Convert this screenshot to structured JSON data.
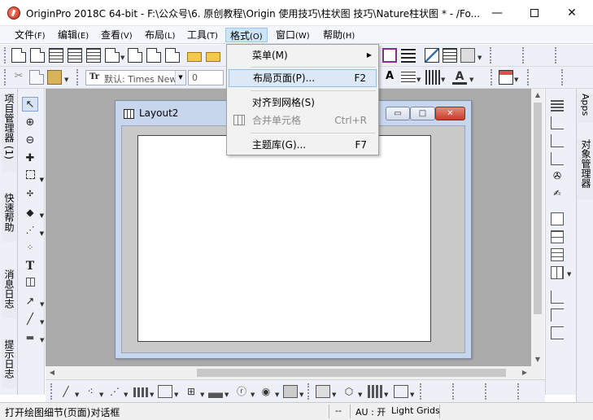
{
  "window": {
    "title": "OriginPro 2018C 64-bit - F:\\公众号\\6. 原创教程\\Origin 使用技巧\\柱状图 技巧\\Nature柱状图 * - /Fo...",
    "minimize_glyph": "—",
    "close_glyph": "✕"
  },
  "menubar": [
    {
      "label": "文件",
      "acc": "(F)"
    },
    {
      "label": "编辑",
      "acc": "(E)"
    },
    {
      "label": "查看",
      "acc": "(V)"
    },
    {
      "label": "布局",
      "acc": "(L)"
    },
    {
      "label": "工具",
      "acc": "(T)"
    },
    {
      "label": "格式",
      "acc": "(O)"
    },
    {
      "label": "窗口",
      "acc": "(W)"
    },
    {
      "label": "帮助",
      "acc": "(H)"
    }
  ],
  "toolbar2": {
    "font_name": "默认: Times New",
    "font_size": "0",
    "font_icon": "Tr"
  },
  "format_menu": {
    "items": [
      {
        "label": "菜单(M)",
        "shortcut": "",
        "submenu": true
      },
      {
        "label": "布局页面(P)...",
        "shortcut": "F2"
      },
      {
        "label": "对齐到网格(S)",
        "shortcut": ""
      },
      {
        "label": "合并单元格",
        "shortcut": "Ctrl+R",
        "disabled": true
      },
      {
        "label": "主题库(G)...",
        "shortcut": "F7"
      }
    ],
    "submenu_arrow": "▶"
  },
  "left_tabs": [
    {
      "label": "项目管理器 (1)"
    },
    {
      "label": "快速帮助"
    },
    {
      "label": "消息日志"
    },
    {
      "label": "提示日志"
    }
  ],
  "right_tabs": [
    {
      "label": "Apps"
    },
    {
      "label": "对象管理器"
    }
  ],
  "layout_window": {
    "title": "Layout2",
    "min_glyph": "▭",
    "max_glyph": "□",
    "close_glyph": "✕"
  },
  "left_tools": {
    "pointer": "↖",
    "zoom_in": "⊕",
    "zoom_out": "⊖",
    "data_reader": "✚",
    "text": "T",
    "arrow": "↗",
    "line": "╱",
    "rect": "▬"
  },
  "statusbar": {
    "text": "打开绘图细节(页面)对话框",
    "seg1": "--",
    "au": "AU : 开",
    "grid": "Light Grids"
  },
  "scroll": {
    "up": "▲",
    "down": "▼",
    "left": "◀",
    "right": "▶"
  }
}
